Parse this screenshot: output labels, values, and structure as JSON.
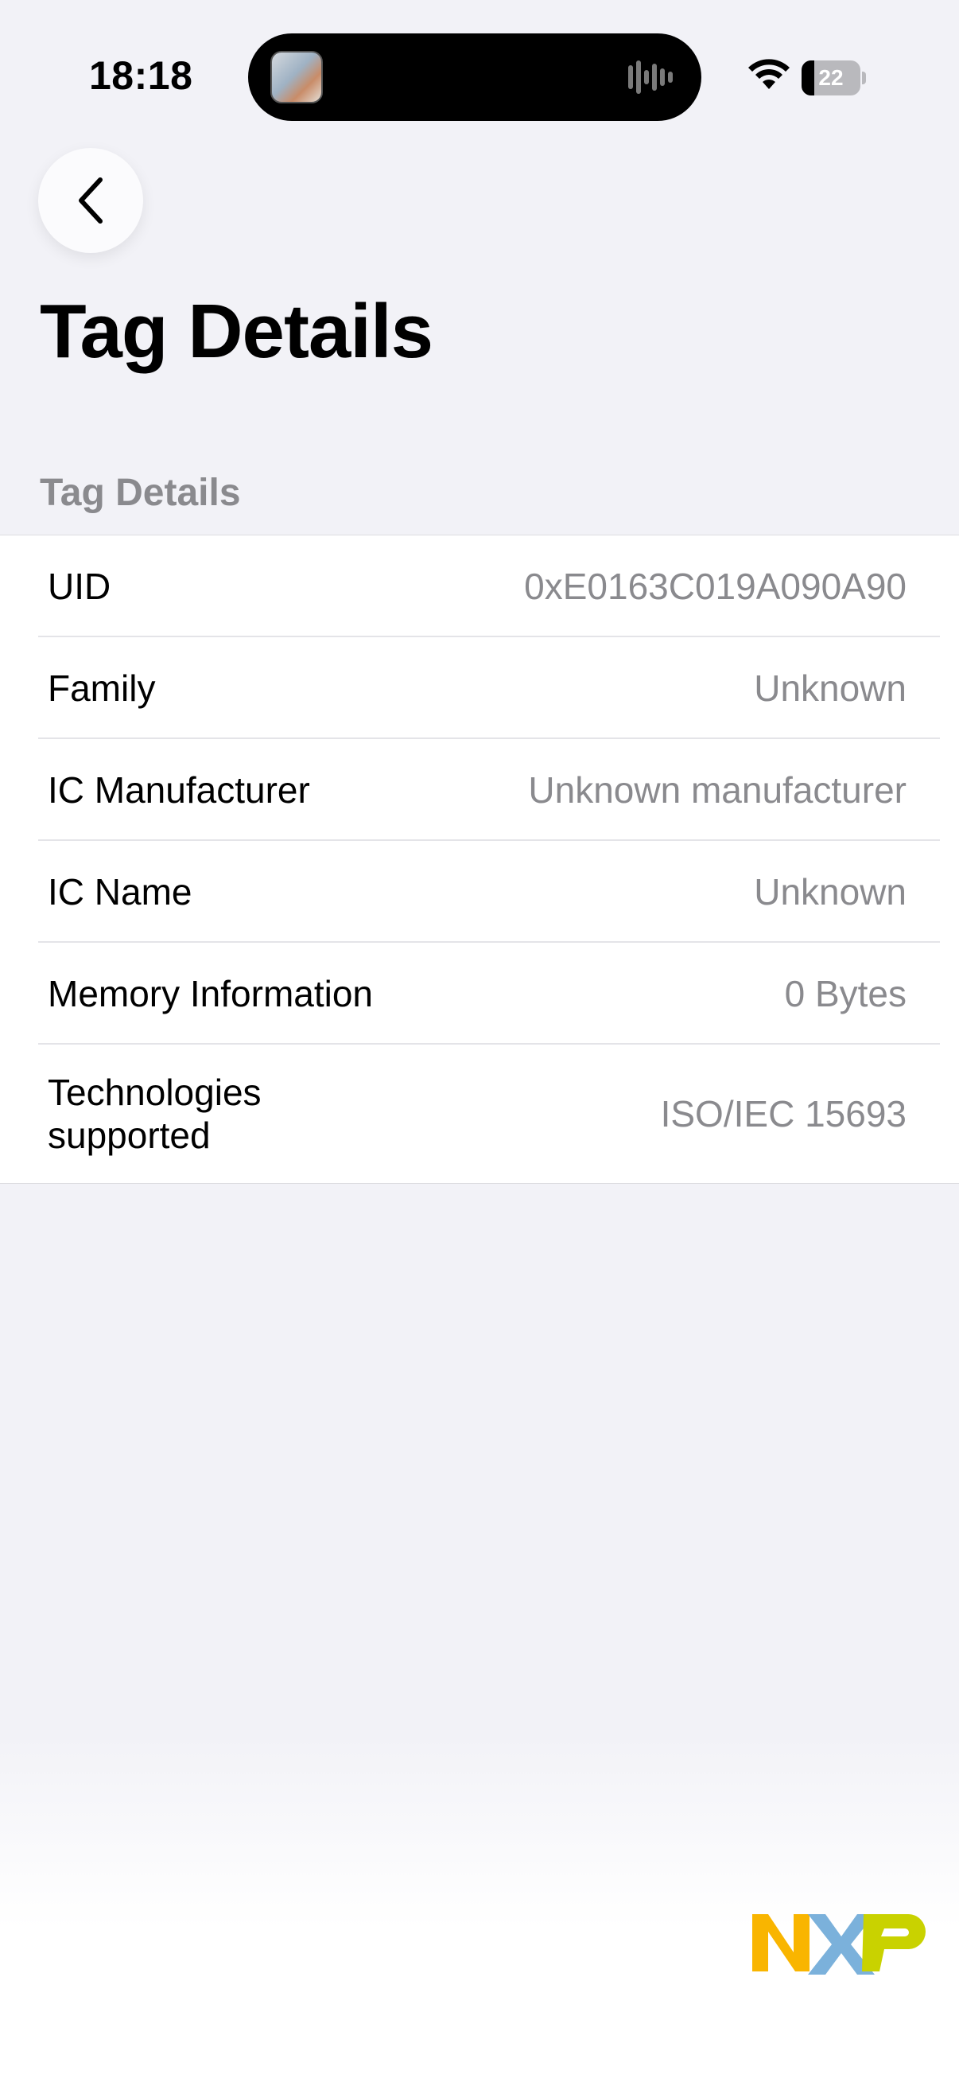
{
  "status_bar": {
    "time": "18:18",
    "battery_level": "22",
    "battery_fraction": 0.22,
    "icons": [
      "wifi-icon",
      "battery-icon",
      "audio-waveform-icon"
    ]
  },
  "nav": {
    "back_icon": "chevron-left-icon",
    "title": "Tag Details"
  },
  "section": {
    "header": "Tag Details",
    "rows": [
      {
        "label": "UID",
        "value": "0xE0163C019A090A90"
      },
      {
        "label": "Family",
        "value": "Unknown"
      },
      {
        "label": "IC Manufacturer",
        "value": "Unknown manufacturer"
      },
      {
        "label": "IC Name",
        "value": "Unknown"
      },
      {
        "label": "Memory Information",
        "value": "0 Bytes"
      },
      {
        "label": "Technologies supported",
        "value": "ISO/IEC 15693"
      }
    ]
  },
  "brand": {
    "logo": "NXP",
    "colors": {
      "n": "#F9B500",
      "x": "#7BB1DB",
      "p": "#C9D200"
    }
  }
}
